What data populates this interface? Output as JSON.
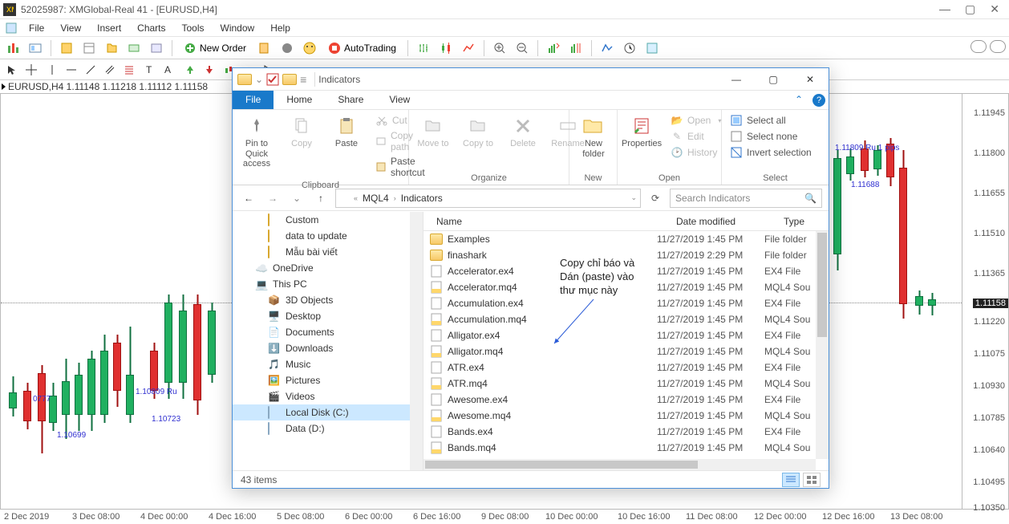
{
  "mt4": {
    "title": "52025987: XMGlobal-Real 41 - [EURUSD,H4]",
    "menu": [
      "File",
      "View",
      "Insert",
      "Charts",
      "Tools",
      "Window",
      "Help"
    ],
    "neworder_label": "New Order",
    "autotrading_label": "AutoTrading",
    "pair_header": "EURUSD,H4  1.11148 1.11218 1.11112 1.11158",
    "price_labels": {
      "top_right": "1.11809  Ru    1 pips",
      "under_right": "1.11688",
      "mid_left_a": "0777",
      "mid_left_b": "1.10699",
      "mid_center_a": "1.10809  Ru",
      "mid_center_b": "1.10723"
    },
    "yticks": [
      "1.11945",
      "1.11800",
      "1.11655",
      "1.11510",
      "1.11365",
      "1.11220",
      "1.11075",
      "1.10930",
      "1.10785",
      "1.10640",
      "1.10495",
      "1.10350"
    ],
    "ytick_current": "1.11158",
    "xticks": [
      "2 Dec 2019",
      "3 Dec 08:00",
      "4 Dec 00:00",
      "4 Dec 16:00",
      "5 Dec 08:00",
      "6 Dec 00:00",
      "6 Dec 16:00",
      "9 Dec 08:00",
      "10 Dec 00:00",
      "10 Dec 16:00",
      "11 Dec 08:00",
      "12 Dec 00:00",
      "12 Dec 16:00",
      "13 Dec 08:00"
    ]
  },
  "explorer": {
    "title": "Indicators",
    "tabs": {
      "file": "File",
      "home": "Home",
      "share": "Share",
      "view": "View"
    },
    "ribbon": {
      "pin": "Pin to Quick access",
      "copy": "Copy",
      "paste": "Paste",
      "cut": "Cut",
      "copypath": "Copy path",
      "pasteshortcut": "Paste shortcut",
      "moveto": "Move to",
      "copyto": "Copy to",
      "delete": "Delete",
      "rename": "Rename",
      "newfolder": "New folder",
      "properties": "Properties",
      "open": "Open",
      "edit": "Edit",
      "history": "History",
      "selectall": "Select all",
      "selectnone": "Select none",
      "invert": "Invert selection",
      "g_clipboard": "Clipboard",
      "g_organize": "Organize",
      "g_new": "New",
      "g_open": "Open",
      "g_select": "Select"
    },
    "breadcrumb": [
      "MQL4",
      "Indicators"
    ],
    "search_placeholder": "Search Indicators",
    "tree": {
      "items": [
        {
          "label": "Custom",
          "lvl": 1,
          "icon": "folder"
        },
        {
          "label": "data to update",
          "lvl": 1,
          "icon": "folder"
        },
        {
          "label": "Mẫu bài viết",
          "lvl": 1,
          "icon": "folder"
        },
        {
          "label": "OneDrive",
          "lvl": 0,
          "icon": "cloud"
        },
        {
          "label": "This PC",
          "lvl": 0,
          "icon": "pc"
        },
        {
          "label": "3D Objects",
          "lvl": 1,
          "icon": "3d"
        },
        {
          "label": "Desktop",
          "lvl": 1,
          "icon": "desktop"
        },
        {
          "label": "Documents",
          "lvl": 1,
          "icon": "docs"
        },
        {
          "label": "Downloads",
          "lvl": 1,
          "icon": "downloads"
        },
        {
          "label": "Music",
          "lvl": 1,
          "icon": "music"
        },
        {
          "label": "Pictures",
          "lvl": 1,
          "icon": "pictures"
        },
        {
          "label": "Videos",
          "lvl": 1,
          "icon": "videos"
        },
        {
          "label": "Local Disk (C:)",
          "lvl": 1,
          "icon": "drive",
          "sel": true
        },
        {
          "label": "Data (D:)",
          "lvl": 1,
          "icon": "drive"
        }
      ]
    },
    "columns": {
      "name": "Name",
      "date": "Date modified",
      "type": "Type"
    },
    "files": [
      {
        "name": "Examples",
        "date": "11/27/2019 1:45 PM",
        "type": "File folder",
        "icon": "folder"
      },
      {
        "name": "finashark",
        "date": "11/27/2019 2:29 PM",
        "type": "File folder",
        "icon": "folder"
      },
      {
        "name": "Accelerator.ex4",
        "date": "11/27/2019 1:45 PM",
        "type": "EX4 File",
        "icon": "ex4"
      },
      {
        "name": "Accelerator.mq4",
        "date": "11/27/2019 1:45 PM",
        "type": "MQL4 Sou",
        "icon": "mq4"
      },
      {
        "name": "Accumulation.ex4",
        "date": "11/27/2019 1:45 PM",
        "type": "EX4 File",
        "icon": "ex4"
      },
      {
        "name": "Accumulation.mq4",
        "date": "11/27/2019 1:45 PM",
        "type": "MQL4 Sou",
        "icon": "mq4"
      },
      {
        "name": "Alligator.ex4",
        "date": "11/27/2019 1:45 PM",
        "type": "EX4 File",
        "icon": "ex4"
      },
      {
        "name": "Alligator.mq4",
        "date": "11/27/2019 1:45 PM",
        "type": "MQL4 Sou",
        "icon": "mq4"
      },
      {
        "name": "ATR.ex4",
        "date": "11/27/2019 1:45 PM",
        "type": "EX4 File",
        "icon": "ex4"
      },
      {
        "name": "ATR.mq4",
        "date": "11/27/2019 1:45 PM",
        "type": "MQL4 Sou",
        "icon": "mq4"
      },
      {
        "name": "Awesome.ex4",
        "date": "11/27/2019 1:45 PM",
        "type": "EX4 File",
        "icon": "ex4"
      },
      {
        "name": "Awesome.mq4",
        "date": "11/27/2019 1:45 PM",
        "type": "MQL4 Sou",
        "icon": "mq4"
      },
      {
        "name": "Bands.ex4",
        "date": "11/27/2019 1:45 PM",
        "type": "EX4 File",
        "icon": "ex4"
      },
      {
        "name": "Bands.mq4",
        "date": "11/27/2019 1:45 PM",
        "type": "MQL4 Sou",
        "icon": "mq4"
      }
    ],
    "status": "43 items"
  },
  "annotation": "Copy chỉ báo và\nDán (paste) vào\nthư mục này"
}
